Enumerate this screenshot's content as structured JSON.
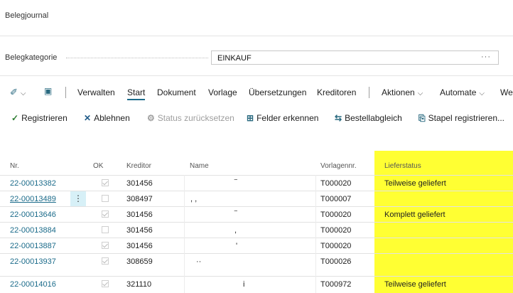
{
  "page": {
    "title": "Belegjournal"
  },
  "filter": {
    "label": "Belegkategorie",
    "value": "EINKAUF",
    "more": "···"
  },
  "menu": {
    "items": [
      "Verwalten",
      "Start",
      "Dokument",
      "Vorlage",
      "Übersetzungen",
      "Kreditoren",
      "Aktionen",
      "Automate",
      "We"
    ],
    "active": "Start"
  },
  "actions": [
    {
      "label": "Registrieren",
      "icon": "checkmark-icon",
      "disabled": false
    },
    {
      "label": "Ablehnen",
      "icon": "x-icon",
      "disabled": false
    },
    {
      "label": "Status zurücksetzen",
      "icon": "gear-icon",
      "disabled": true
    },
    {
      "label": "Felder erkennen",
      "icon": "detect-fields-icon",
      "disabled": false
    },
    {
      "label": "Bestellabgleich",
      "icon": "order-match-icon",
      "disabled": false
    },
    {
      "label": "Stapel registrieren...",
      "icon": "batch-post-icon",
      "disabled": false
    }
  ],
  "table": {
    "columns": [
      "Nr.",
      "OK",
      "Kreditor",
      "Name",
      "Vorlagennr.",
      "Lieferstatus"
    ],
    "rows": [
      {
        "nr": "22-00013382",
        "ok": true,
        "kreditor": "301456",
        "name": "‾",
        "vorlage": "T000020",
        "status": "Teilweise geliefert"
      },
      {
        "nr": "22-00013489",
        "ok": false,
        "kreditor": "308497",
        "name": ",   ,",
        "vorlage": "T000007",
        "status": ""
      },
      {
        "nr": "22-00013646",
        "ok": true,
        "kreditor": "301456",
        "name": "‾",
        "vorlage": "T000020",
        "status": "Komplett geliefert"
      },
      {
        "nr": "22-00013884",
        "ok": false,
        "kreditor": "301456",
        "name": ",",
        "vorlage": "T000020",
        "status": ""
      },
      {
        "nr": "22-00013887",
        "ok": true,
        "kreditor": "301456",
        "name": "'",
        "vorlage": "T000020",
        "status": ""
      },
      {
        "nr": "22-00013937",
        "ok": true,
        "kreditor": "308659",
        "name": "··",
        "vorlage": "T000026",
        "status": ""
      },
      {
        "nr": "22-00014016",
        "ok": true,
        "kreditor": "321110",
        "name": "i",
        "vorlage": "T000972",
        "status": "Teilweise geliefert"
      }
    ]
  },
  "colors": {
    "accent": "#1b6b8a",
    "highlight": "#ffff33",
    "selected_row_handle": "#d7f0f7"
  }
}
